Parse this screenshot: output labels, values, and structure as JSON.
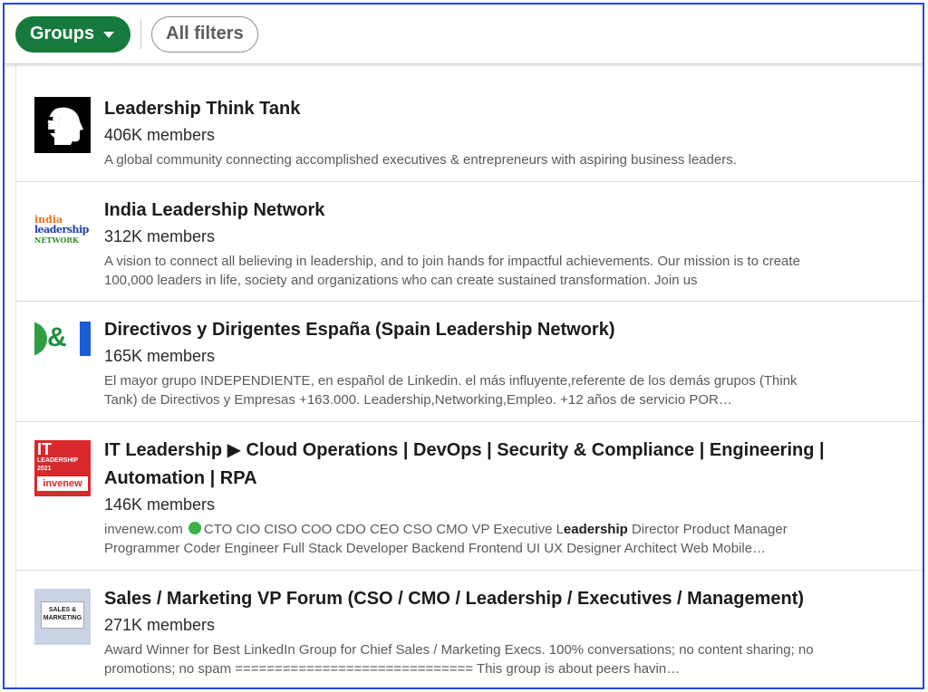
{
  "filters": {
    "groups_label": "Groups",
    "all_filters_label": "All filters"
  },
  "colors": {
    "accent_green": "#157a3b",
    "frame_border": "#2545d6",
    "status_dot": "#3db046"
  },
  "results": [
    {
      "title": "Leadership Think Tank",
      "members": "406K members",
      "description": "A global community connecting accomplished executives & entrepreneurs with aspiring business leaders.",
      "logo_icon": "leadership-think-tank-logo"
    },
    {
      "title": "India Leadership Network",
      "members": "312K members",
      "description": "A vision to connect all believing in leadership, and to join hands for impactful achievements. Our mission is to create 100,000 leaders in life, society and organizations who can create sustained transformation. Join us",
      "logo_icon": "india-leadership-network-logo",
      "logo_text": {
        "line1": "india",
        "line2": "leadership",
        "line3": "NETWORK"
      }
    },
    {
      "title": "Directivos y Dirigentes España (Spain Leadership Network)",
      "members": "165K members",
      "description": "El mayor grupo INDEPENDIENTE, en español de Linkedin. el más influyente,referente de los demás grupos (Think Tank) de Directivos y Empresas +163.000. Leadership,Networking,Empleo. +12 años de servicio POR…",
      "logo_icon": "directivos-dirigentes-logo",
      "logo_text": "D&"
    },
    {
      "title": "IT Leadership ▶ Cloud Operations | DevOps | Security & Compliance | Engineering | Automation | RPA",
      "members": "146K members",
      "description_pre": "invenew.com",
      "description_mid": "CTO CIO CISO COO CDO CEO CSO CMO VP Executive L",
      "description_bold": "eadership",
      "description_post": "Director Product Manager Programmer Coder Engineer Full Stack Developer Backend Frontend UI UX Designer Architect Web Mobile…",
      "logo_icon": "it-leadership-logo",
      "logo_text": {
        "line1": "IT",
        "line2": "LEADERSHIP",
        "line3": "2021",
        "line4": "invenew"
      }
    },
    {
      "title": "Sales / Marketing VP Forum (CSO / CMO / Leadership / Executives / Management)",
      "members": "271K members",
      "description": "Award Winner for Best LinkedIn Group for Chief Sales / Marketing Execs. 100% conversations; no content sharing; no promotions; no spam ============================== This group is about peers havin…",
      "logo_icon": "sales-marketing-logo",
      "logo_text": {
        "line1": "SALES &",
        "line2": "MARKETING"
      }
    }
  ]
}
